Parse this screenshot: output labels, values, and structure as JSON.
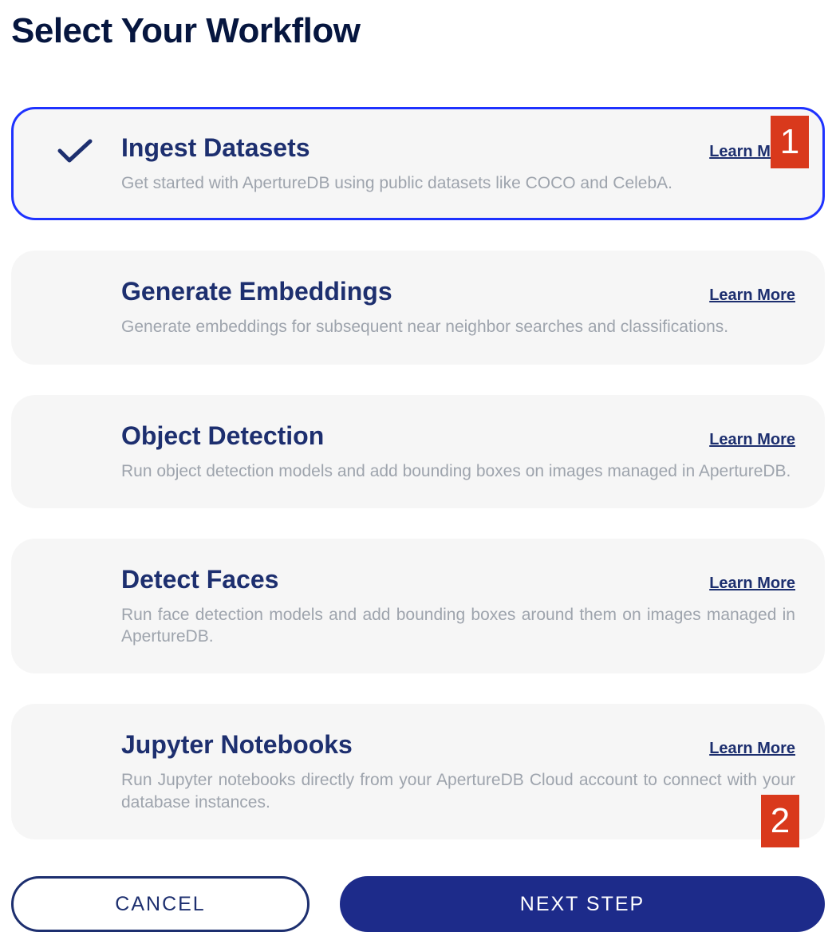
{
  "page_title": "Select Your Workflow",
  "learn_more_label": "Learn More",
  "workflows": [
    {
      "title": "Ingest Datasets",
      "description": "Get started with ApertureDB using public datasets like COCO and CelebA.",
      "selected": true,
      "justify": false
    },
    {
      "title": "Generate Embeddings",
      "description": "Generate embeddings for subsequent near neighbor searches and classifications.",
      "selected": false,
      "justify": false
    },
    {
      "title": "Object Detection",
      "description": "Run object detection models and add bounding boxes on images managed in ApertureDB.",
      "selected": false,
      "justify": true
    },
    {
      "title": "Detect Faces",
      "description": "Run face detection models and add bounding boxes around them on images managed in ApertureDB.",
      "selected": false,
      "justify": true
    },
    {
      "title": "Jupyter Notebooks",
      "description": "Run Jupyter notebooks directly from your ApertureDB Cloud account to connect with your database instances.",
      "selected": false,
      "justify": true
    }
  ],
  "buttons": {
    "cancel": "CANCEL",
    "next": "NEXT STEP"
  },
  "annotations": {
    "a1": "1",
    "a2": "2"
  }
}
